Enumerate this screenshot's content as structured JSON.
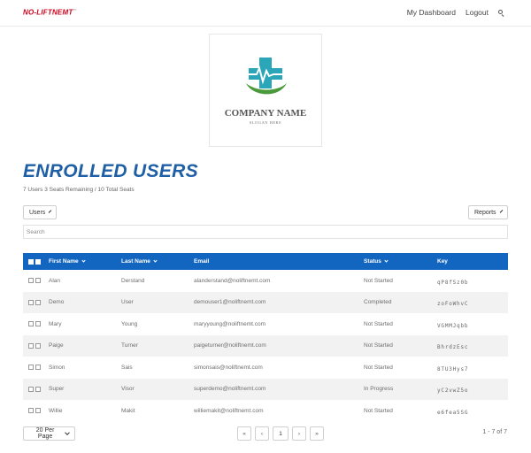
{
  "header": {
    "brand": "NO-LIFTNEMT",
    "brand_mark": "™",
    "nav": {
      "dashboard": "My Dashboard",
      "logout": "Logout"
    }
  },
  "logo": {
    "company": "COMPANY NAME",
    "slogan": "SLOGAN HERE"
  },
  "page": {
    "title": "ENROLLED USERS",
    "subtitle": "7 Users 3 Seats Remaining / 10 Total Seats"
  },
  "toolbar": {
    "users_label": "Users",
    "reports_label": "Reports"
  },
  "search": {
    "placeholder": "Search"
  },
  "table": {
    "columns": {
      "first": "First Name",
      "last": "Last Name",
      "email": "Email",
      "status": "Status",
      "key": "Key"
    },
    "rows": [
      {
        "first": "Alan",
        "last": "Derstand",
        "email": "alanderstand@noliftnemt.com",
        "status": "Not Started",
        "key": "qP8fSz0b"
      },
      {
        "first": "Demo",
        "last": "User",
        "email": "demouser1@noliftnemt.com",
        "status": "Completed",
        "key": "zoFoWhvC"
      },
      {
        "first": "Mary",
        "last": "Young",
        "email": "maryyoung@noliftnemt.com",
        "status": "Not Started",
        "key": "VGMMJqbb"
      },
      {
        "first": "Paige",
        "last": "Turner",
        "email": "paigeturner@noliftnemt.com",
        "status": "Not Started",
        "key": "BhrdzEsc"
      },
      {
        "first": "Simon",
        "last": "Sais",
        "email": "simonsais@noliftnemt.com",
        "status": "Not Started",
        "key": "8TU3Hys7"
      },
      {
        "first": "Super",
        "last": "Visor",
        "email": "superdemo@noliftnemt.com",
        "status": "In Progress",
        "key": "yC2vwZ5o"
      },
      {
        "first": "Willie",
        "last": "Makit",
        "email": "williemakit@noliftnemt.com",
        "status": "Not Started",
        "key": "e6fea5SG"
      }
    ]
  },
  "footer": {
    "per_page": "20 Per Page",
    "pager": {
      "first": "«",
      "prev": "‹",
      "page": "1",
      "next": "›",
      "last": "»"
    },
    "range": "1 - 7 of 7"
  },
  "colors": {
    "brand": "#d0021b",
    "title": "#1f5fa6",
    "table_header": "#1366c0",
    "logo_teal": "#2aa6b8",
    "logo_green": "#4a9a3c"
  }
}
